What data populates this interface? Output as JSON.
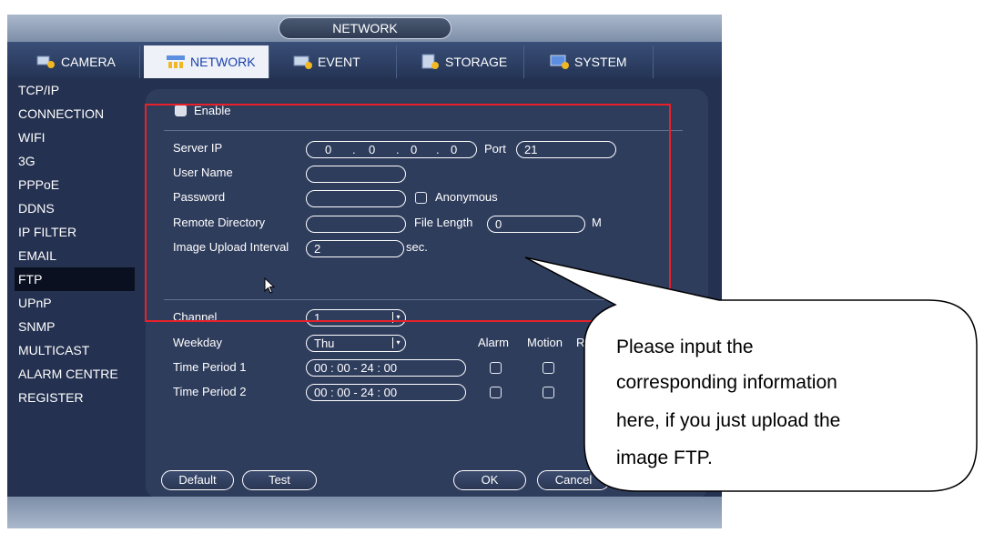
{
  "window": {
    "title": "NETWORK"
  },
  "tabs": [
    {
      "label": "CAMERA",
      "icon": "camera-settings-icon"
    },
    {
      "label": "NETWORK",
      "icon": "network-icon"
    },
    {
      "label": "EVENT",
      "icon": "event-icon"
    },
    {
      "label": "STORAGE",
      "icon": "storage-icon"
    },
    {
      "label": "SYSTEM",
      "icon": "system-icon"
    }
  ],
  "sidebar": {
    "items": [
      "TCP/IP",
      "CONNECTION",
      "WIFI",
      "3G",
      "PPPoE",
      "DDNS",
      "IP FILTER",
      "EMAIL",
      "FTP",
      "UPnP",
      "SNMP",
      "MULTICAST",
      "ALARM CENTRE",
      "REGISTER"
    ],
    "active": "FTP"
  },
  "form": {
    "enable_label": "Enable",
    "server_ip_label": "Server IP",
    "server_ip": [
      "0",
      "0",
      "0",
      "0"
    ],
    "port_label": "Port",
    "port_value": "21",
    "user_name_label": "User Name",
    "user_name_value": "",
    "password_label": "Password",
    "password_value": "",
    "anonymous_label": "Anonymous",
    "remote_dir_label": "Remote Directory",
    "remote_dir_value": "",
    "file_length_label": "File Length",
    "file_length_value": "0",
    "file_length_unit": "M",
    "upload_interval_label": "Image Upload Interval",
    "upload_interval_value": "2",
    "upload_interval_unit": "sec.",
    "channel_label": "Channel",
    "channel_value": "1",
    "weekday_label": "Weekday",
    "weekday_value": "Thu",
    "alarm_label": "Alarm",
    "motion_label": "Motion",
    "regular_partial": "R",
    "period1_label": "Time Period 1",
    "period1_value": "00 : 00 - 24 : 00",
    "period2_label": "Time Period 2",
    "period2_value": "00 : 00 - 24 : 00"
  },
  "buttons": {
    "default": "Default",
    "test": "Test",
    "ok": "OK",
    "cancel": "Cancel"
  },
  "callout": {
    "lines": [
      "Please input the",
      "corresponding information",
      "here, if you just upload the",
      "image FTP."
    ]
  },
  "colors": {
    "highlight": "#e8202a",
    "panel": "#2f3d5d",
    "background": "#243150"
  }
}
